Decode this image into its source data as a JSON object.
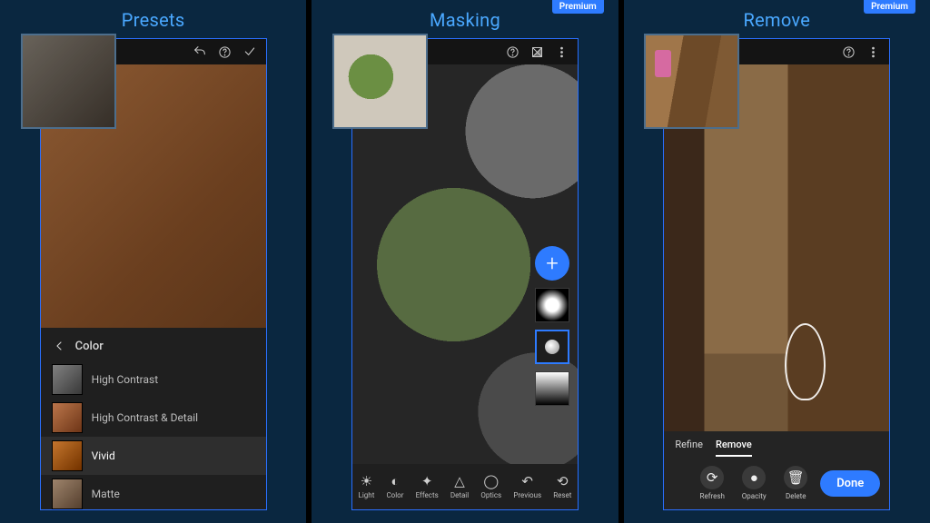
{
  "premium_label": "Premium",
  "panel1": {
    "title": "Presets",
    "toolbar": {
      "undo": "undo-icon",
      "help": "help-icon",
      "confirm": "check-icon"
    },
    "drawer": {
      "back_label": "Color",
      "items": [
        {
          "label": "High Contrast",
          "selected": false
        },
        {
          "label": "High Contrast & Detail",
          "selected": false
        },
        {
          "label": "Vivid",
          "selected": true
        },
        {
          "label": "Matte",
          "selected": false
        }
      ]
    }
  },
  "panel2": {
    "title": "Masking",
    "toolbar": {
      "help": "help-icon",
      "invert": "invert-icon",
      "more": "more-icon"
    },
    "rail": {
      "add": "+",
      "mask1": "radial-mask",
      "selected": "point-mask",
      "grad": "gradient-mask"
    },
    "tools": [
      {
        "label": "Light",
        "icon": "light-icon"
      },
      {
        "label": "Color",
        "icon": "color-icon"
      },
      {
        "label": "Effects",
        "icon": "effects-icon"
      },
      {
        "label": "Detail",
        "icon": "detail-icon"
      },
      {
        "label": "Optics",
        "icon": "optics-icon"
      },
      {
        "label": "Previous",
        "icon": "previous-icon"
      },
      {
        "label": "Reset",
        "icon": "reset-icon"
      }
    ]
  },
  "panel3": {
    "title": "Remove",
    "toolbar": {
      "help": "help-icon",
      "more": "more-icon"
    },
    "tabs": [
      {
        "label": "Refine",
        "active": false
      },
      {
        "label": "Remove",
        "active": true
      }
    ],
    "actions": [
      {
        "label": "Refresh",
        "icon": "refresh-icon"
      },
      {
        "label": "Opacity",
        "icon": "opacity-icon"
      },
      {
        "label": "Delete",
        "icon": "delete-icon"
      }
    ],
    "done_label": "Done"
  }
}
